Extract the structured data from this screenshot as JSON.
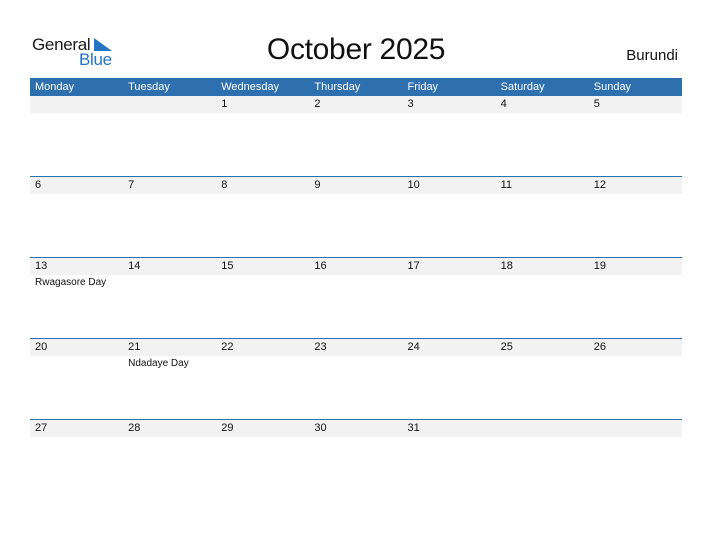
{
  "logo": {
    "line1": "General",
    "line2": "Blue",
    "icon": "blue-triangle-icon",
    "brand_color": "#2574c5"
  },
  "title": "October 2025",
  "country": "Burundi",
  "colors": {
    "header_bg": "#2e6fb0",
    "date_strip_bg": "#f2f2f2"
  },
  "weekdays": [
    "Monday",
    "Tuesday",
    "Wednesday",
    "Thursday",
    "Friday",
    "Saturday",
    "Sunday"
  ],
  "weeks": [
    {
      "days": [
        {
          "num": "",
          "event": ""
        },
        {
          "num": "",
          "event": ""
        },
        {
          "num": "1",
          "event": ""
        },
        {
          "num": "2",
          "event": ""
        },
        {
          "num": "3",
          "event": ""
        },
        {
          "num": "4",
          "event": ""
        },
        {
          "num": "5",
          "event": ""
        }
      ]
    },
    {
      "days": [
        {
          "num": "6",
          "event": ""
        },
        {
          "num": "7",
          "event": ""
        },
        {
          "num": "8",
          "event": ""
        },
        {
          "num": "9",
          "event": ""
        },
        {
          "num": "10",
          "event": ""
        },
        {
          "num": "11",
          "event": ""
        },
        {
          "num": "12",
          "event": ""
        }
      ]
    },
    {
      "days": [
        {
          "num": "13",
          "event": "Rwagasore Day"
        },
        {
          "num": "14",
          "event": ""
        },
        {
          "num": "15",
          "event": ""
        },
        {
          "num": "16",
          "event": ""
        },
        {
          "num": "17",
          "event": ""
        },
        {
          "num": "18",
          "event": ""
        },
        {
          "num": "19",
          "event": ""
        }
      ]
    },
    {
      "days": [
        {
          "num": "20",
          "event": ""
        },
        {
          "num": "21",
          "event": "Ndadaye Day"
        },
        {
          "num": "22",
          "event": ""
        },
        {
          "num": "23",
          "event": ""
        },
        {
          "num": "24",
          "event": ""
        },
        {
          "num": "25",
          "event": ""
        },
        {
          "num": "26",
          "event": ""
        }
      ]
    },
    {
      "days": [
        {
          "num": "27",
          "event": ""
        },
        {
          "num": "28",
          "event": ""
        },
        {
          "num": "29",
          "event": ""
        },
        {
          "num": "30",
          "event": ""
        },
        {
          "num": "31",
          "event": ""
        },
        {
          "num": "",
          "event": ""
        },
        {
          "num": "",
          "event": ""
        }
      ]
    }
  ]
}
